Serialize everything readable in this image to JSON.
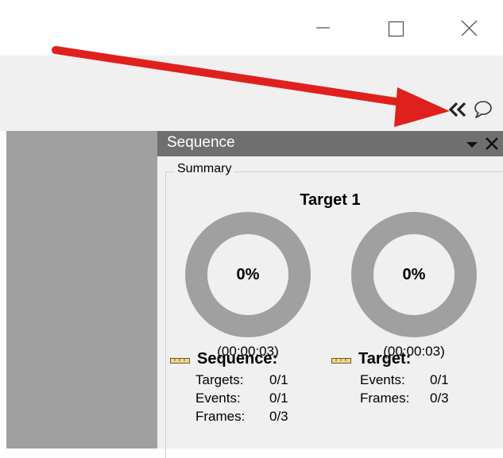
{
  "window": {
    "minimize_icon": "minimize-icon",
    "maximize_icon": "maximize-icon",
    "close_icon": "close-icon"
  },
  "toolbar": {
    "collapse_icon": "double-chevron-left-icon",
    "comment_icon": "speech-bubble-icon"
  },
  "annotation": {
    "arrow_color": "#e0201c"
  },
  "panel": {
    "title": "Sequence",
    "dropdown_icon": "dropdown-arrow-icon",
    "close_icon": "close-icon",
    "header_color": "#6f6f6f"
  },
  "summary": {
    "group_label": "Summary",
    "target_title": "Target 1",
    "left_gauge": {
      "percent_text": "0%",
      "progress": 0,
      "time": "(00:00:03)"
    },
    "right_gauge": {
      "percent_text": "0%",
      "progress": 0,
      "time": "(00:00:03)"
    },
    "sequence": {
      "heading": "Sequence:",
      "stats": [
        {
          "label": "Targets:",
          "value": "0/1"
        },
        {
          "label": "Events:",
          "value": "0/1"
        },
        {
          "label": "Frames:",
          "value": "0/3"
        }
      ]
    },
    "target": {
      "heading": "Target:",
      "stats": [
        {
          "label": "Events:",
          "value": "0/1"
        },
        {
          "label": "Frames:",
          "value": "0/3"
        }
      ]
    }
  }
}
